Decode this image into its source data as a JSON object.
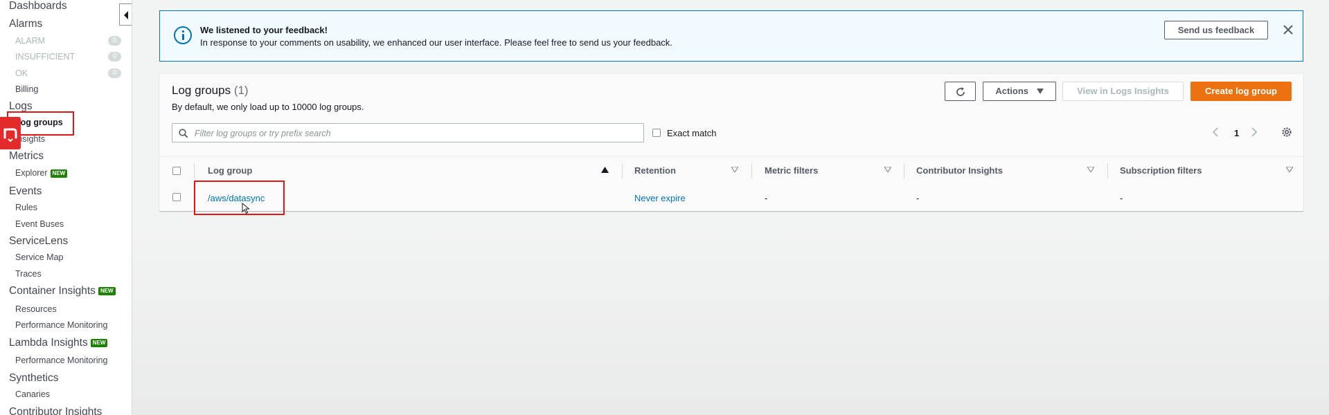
{
  "sidebar": {
    "dashboards": "Dashboards",
    "alarms": "Alarms",
    "alarm_items": [
      {
        "label": "ALARM",
        "count": "0"
      },
      {
        "label": "INSUFFICIENT",
        "count": "0"
      },
      {
        "label": "OK",
        "count": "0"
      }
    ],
    "billing": "Billing",
    "logs": "Logs",
    "log_groups": "Log groups",
    "insights": "Insights",
    "metrics": "Metrics",
    "explorer": "Explorer",
    "new_badge": "NEW",
    "events": "Events",
    "rules": "Rules",
    "event_buses": "Event Buses",
    "servicelens": "ServiceLens",
    "service_map": "Service Map",
    "traces": "Traces",
    "container_insights": "Container Insights",
    "resources": "Resources",
    "performance_monitoring": "Performance Monitoring",
    "lambda_insights": "Lambda Insights",
    "synthetics": "Synthetics",
    "canaries": "Canaries",
    "contributor_insights": "Contributor Insights"
  },
  "banner": {
    "title": "We listened to your feedback!",
    "text": "In response to your comments on usability, we enhanced our user interface. Please feel free to send us your feedback.",
    "feedback_button": "Send us feedback"
  },
  "panel": {
    "title": "Log groups",
    "count": "(1)",
    "description": "By default, we only load up to 10000 log groups.",
    "actions_label": "Actions",
    "view_insights_label": "View in Logs Insights",
    "create_label": "Create log group",
    "search_placeholder": "Filter log groups or try prefix search",
    "exact_match_label": "Exact match",
    "page_number": "1"
  },
  "table": {
    "columns": [
      "Log group",
      "Retention",
      "Metric filters",
      "Contributor Insights",
      "Subscription filters"
    ],
    "rows": [
      {
        "log_group": "/aws/datasync",
        "retention": "Never expire",
        "metric_filters": "-",
        "contributor_insights": "-",
        "subscription_filters": "-"
      }
    ]
  },
  "colors": {
    "primary_button": "#ec7211",
    "link": "#0073bb",
    "info": "#0073bb",
    "highlight": "#e01616",
    "new_badge": "#1d8102"
  }
}
